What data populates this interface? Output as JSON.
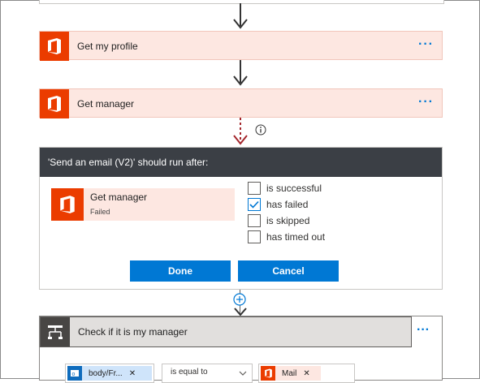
{
  "actions": [
    {
      "title": "Get my profile",
      "more": "..."
    },
    {
      "title": "Get manager",
      "more": "..."
    }
  ],
  "run_after": {
    "header": "'Send an email (V2)' should run after:",
    "source_action": {
      "title": "Get manager",
      "status": "Failed"
    },
    "options": [
      {
        "label": "is successful",
        "checked": false
      },
      {
        "label": "has failed",
        "checked": true
      },
      {
        "label": "is skipped",
        "checked": false
      },
      {
        "label": "has timed out",
        "checked": false
      }
    ],
    "done_label": "Done",
    "cancel_label": "Cancel"
  },
  "condition": {
    "title": "Check if it is my manager",
    "more": "...",
    "left_token": "body/Fr...",
    "operator": "is equal to",
    "right_token": "Mail"
  },
  "colors": {
    "accent": "#0078d4",
    "office": "#eb3c00",
    "header": "#3b3f45",
    "card": "#fde7e1",
    "failed_arrow": "#a4262c"
  },
  "icons": [
    "office-logo-icon",
    "more-options-icon",
    "info-icon",
    "add-step-icon",
    "condition-icon",
    "checkmark-icon",
    "remove-token-icon",
    "chevron-down-icon",
    "outlook-icon"
  ]
}
